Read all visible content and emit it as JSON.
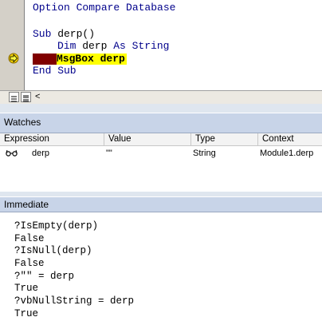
{
  "code": {
    "lines": [
      "Option Compare Database",
      "",
      "Sub derp()",
      "    Dim derp As String",
      "MsgBox derp",
      "End Sub"
    ],
    "option_keyword": "Option Compare Database",
    "sub_keyword": "Sub",
    "sub_rest": " derp()",
    "dim_keyword": "Dim",
    "dim_mid": " derp ",
    "as_keyword": "As",
    "string_keyword": " String",
    "current_statement": "MsgBox derp",
    "end_sub": "End Sub",
    "scroll_left_glyph": "<"
  },
  "watches": {
    "title": "Watches",
    "columns": [
      "Expression",
      "Value",
      "Type",
      "Context"
    ],
    "rows": [
      {
        "expression": "derp",
        "value": "\"\"",
        "type": "String",
        "context": "Module1.derp"
      }
    ]
  },
  "immediate": {
    "title": "Immediate",
    "lines": [
      "?IsEmpty(derp)",
      "False",
      "?IsNull(derp)",
      "False",
      "?\"\" = derp",
      "True",
      "?vbNullString = derp",
      "True"
    ]
  },
  "colors": {
    "keyword": "#00008b",
    "execution_highlight": "#ffff00",
    "breakpoint_bar": "#800000",
    "panel_header": "#c8d4e8"
  },
  "icons": [
    "execution-arrow-icon",
    "watch-glasses-icon",
    "full-module-view-icon",
    "procedure-view-icon",
    "scroll-left-icon"
  ]
}
